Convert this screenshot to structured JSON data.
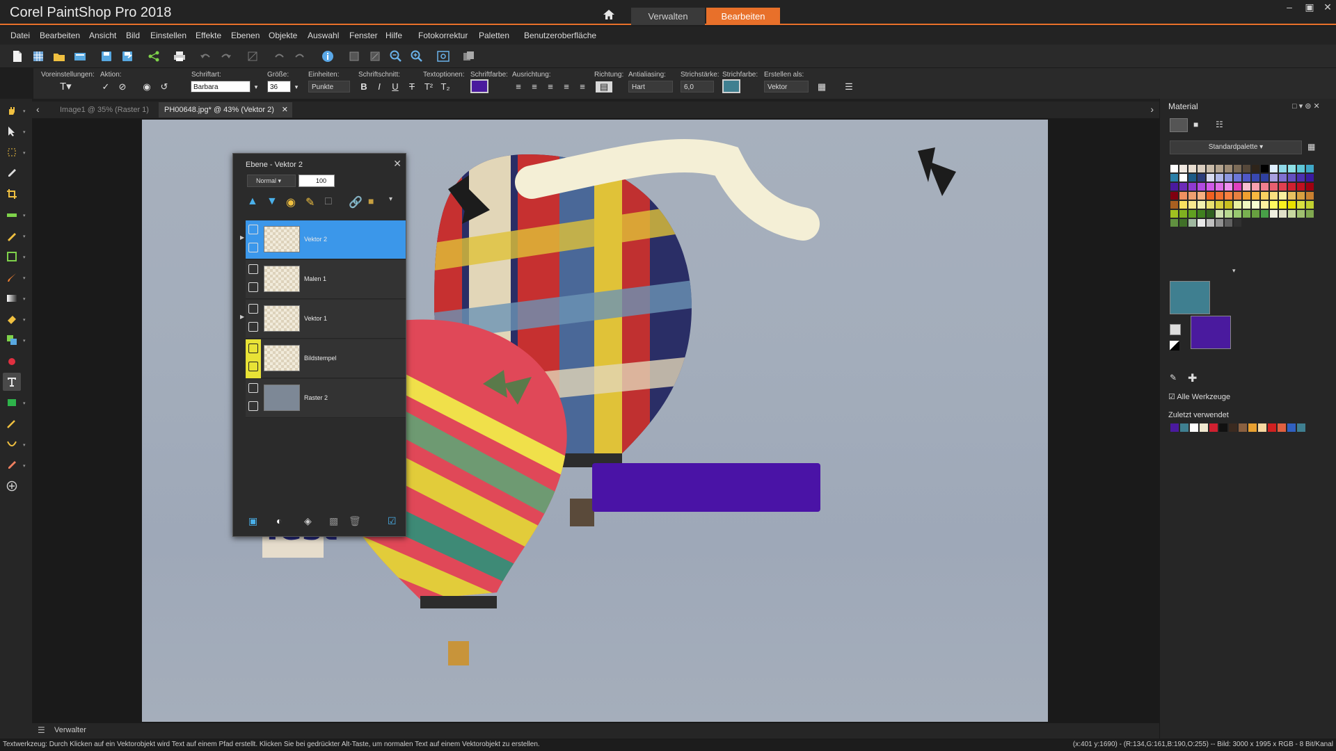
{
  "app": {
    "title": "Corel PaintShop Pro 2018",
    "tabs": {
      "manage": "Verwalten",
      "edit": "Bearbeiten"
    },
    "accent_color": "#e8702a"
  },
  "menu": [
    "Datei",
    "Bearbeiten",
    "Ansicht",
    "Bild",
    "Einstellen",
    "Effekte",
    "Ebenen",
    "Objekte",
    "Auswahl",
    "Fenster",
    "Hilfe",
    "Fotokorrektur",
    "Paletten",
    "Benutzeroberfläche"
  ],
  "options": {
    "presets_label": "Voreinstellungen:",
    "action_label": "Aktion:",
    "font_label": "Schriftart:",
    "font_value": "Barbara",
    "size_label": "Größe:",
    "size_value": "36",
    "units_label": "Einheiten:",
    "units_value": "Punkte",
    "style_label": "Schriftschnitt:",
    "style_buttons": [
      "B",
      "I",
      "U",
      "T",
      "T²",
      "T₂"
    ],
    "textoptions_label": "Textoptionen:",
    "fontcolor_label": "Schriftfarbe:",
    "fontcolor": "#4a1a9e",
    "align_label": "Ausrichtung:",
    "direction_label": "Richtung:",
    "antialias_label": "Antialiasing:",
    "antialias_value": "Hart",
    "stroke_label": "Strichstärke:",
    "stroke_value": "6,0",
    "strokecolor_label": "Strichfarbe:",
    "strokecolor": "#3f7f90",
    "create_label": "Erstellen als:",
    "create_value": "Vektor"
  },
  "doc_tabs": [
    {
      "label": "Image1 @ 35% (Raster 1)",
      "active": false
    },
    {
      "label": "PH00648.jpg* @ 43% (Vektor 2)",
      "active": true
    }
  ],
  "canvas": {
    "text_object": "Test",
    "rect_color": "#4a13a6"
  },
  "layers": {
    "title": "Ebene - Vektor 2",
    "blend_mode": "Normal",
    "opacity": "100",
    "items": [
      {
        "name": "Vektor 2",
        "selected": true,
        "marked": false
      },
      {
        "name": "Malen 1",
        "selected": false,
        "marked": false
      },
      {
        "name": "Vektor 1",
        "selected": false,
        "marked": false
      },
      {
        "name": "Bildstempel",
        "selected": false,
        "marked": true
      },
      {
        "name": "Raster 2",
        "selected": false,
        "marked": false
      }
    ]
  },
  "material": {
    "title": "Material",
    "palette": "Standardpalette",
    "all_tools": "Alle Werkzeuge",
    "recent_title": "Zuletzt verwendet",
    "foreground_color": "#3f7f90",
    "background_color": "#4a1a9e",
    "swatches": [
      "#ffffff",
      "#f0e8e0",
      "#e8ddd0",
      "#d9cdbf",
      "#c9bba9",
      "#b4a48f",
      "#9d8b75",
      "#7c6b57",
      "#56483a",
      "#2e241a",
      "#000000",
      "#dfefff",
      "#8fd8e8",
      "#8ee0e6",
      "#5fc6d6",
      "#3fa8c8",
      "#2a7fa8",
      "#ffffff",
      "#1d5a86",
      "#2c3d7a",
      "#d8dcf0",
      "#b0b8e8",
      "#8e98e0",
      "#6d78d8",
      "#5058c8",
      "#3948b0",
      "#2f40a0",
      "#a8a0e0",
      "#8070d0",
      "#6450c0",
      "#4c30b0",
      "#3a1aa0",
      "#4a1a9e",
      "#6d2ab8",
      "#8f3ad0",
      "#b14ae0",
      "#d05ae8",
      "#e070e8",
      "#f090f0",
      "#e040c0",
      "#f8c0d0",
      "#f8a0b0",
      "#f08090",
      "#e86070",
      "#e04050",
      "#d02030",
      "#c01020",
      "#a00010",
      "#800010",
      "#f09060",
      "#f0a070",
      "#f8b080",
      "#f06020",
      "#f07030",
      "#f88040",
      "#e88040",
      "#f0a030",
      "#f8b840",
      "#f8d060",
      "#f8e080",
      "#f8f0a0",
      "#e8c060",
      "#d8a040",
      "#c88030",
      "#a86020",
      "#f8e060",
      "#f8e890",
      "#f0f0b0",
      "#e8e070",
      "#d8d040",
      "#c8c020",
      "#e8f0a0",
      "#f0f8c0",
      "#f8ffd0",
      "#fff0a0",
      "#fff860",
      "#f8f020",
      "#e8e000",
      "#d8e040",
      "#c0d030",
      "#a0c020",
      "#80b020",
      "#60a020",
      "#408020",
      "#306020",
      "#d0e0b0",
      "#b8d890",
      "#98c870",
      "#78b050",
      "#68a040",
      "#48a048",
      "#f0f0e0",
      "#e0e0c8",
      "#c8d8a0",
      "#a0c070",
      "#80a850",
      "#609040",
      "#407028",
      "#a0b8a0",
      "#e8e8e8",
      "#c0c0c0",
      "#909090",
      "#606060",
      "#303030"
    ],
    "recent": [
      "#4a1a9e",
      "#3f7f90",
      "#ffffff",
      "#f0e8d0",
      "#d02030",
      "#111111",
      "#3a2a20",
      "#8a6040",
      "#e8a030",
      "#f8d8a0",
      "#d02020",
      "#e06040",
      "#3060c0",
      "#3f7f90"
    ]
  },
  "bottom_tab": "Verwalter",
  "status": {
    "left": "Textwerkzeug: Durch Klicken auf ein Vektorobjekt wird Text auf einem Pfad erstellt. Klicken Sie bei gedrückter Alt-Taste, um normalen Text auf einem Vektorobjekt zu erstellen.",
    "right": "(x:401 y:1690) - (R:134,G:161,B:190,O:255) -- Bild:  3000 x 1995 x RGB - 8 Bit/Kanal"
  }
}
